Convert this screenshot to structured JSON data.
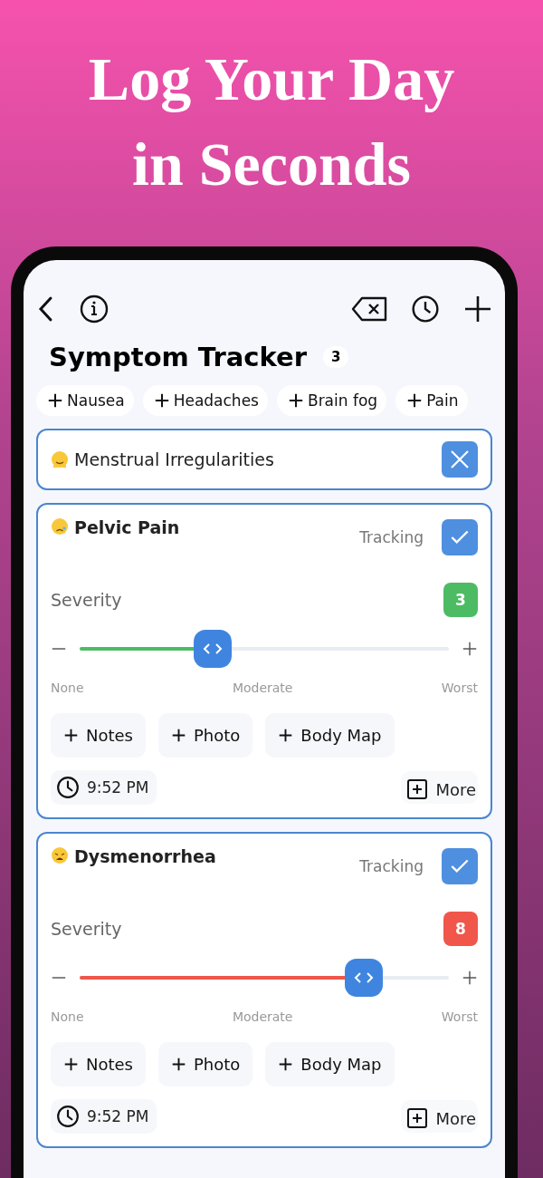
{
  "headline": "Log Your Day in Seconds",
  "screen": {
    "title": "Symptom Tracker",
    "count": "3",
    "quick_add": [
      "Nausea",
      "Headaches",
      "Brain fog",
      "Pain"
    ],
    "symptoms": [
      {
        "kind": "collapsed",
        "name": "Menstrual Irregularities",
        "tracking": false
      },
      {
        "kind": "expanded",
        "name": "Pelvic Pain",
        "tracking_label": "Tracking",
        "tracking": true,
        "severity_label": "Severity",
        "score": "3",
        "color": "#4cbb64",
        "level": 0.36,
        "scale": [
          "None",
          "Moderate",
          "Worst"
        ],
        "actions": [
          "Notes",
          "Photo",
          "Body Map"
        ],
        "time": "9:52 PM",
        "more": "More"
      },
      {
        "kind": "expanded",
        "name": "Dysmenorrhea",
        "tracking_label": "Tracking",
        "tracking": true,
        "severity_label": "Severity",
        "score": "8",
        "color": "#f0564a",
        "level": 0.77,
        "scale": [
          "None",
          "Moderate",
          "Worst"
        ],
        "actions": [
          "Notes",
          "Photo",
          "Body Map"
        ],
        "time": "9:52 PM",
        "more": "More"
      }
    ]
  }
}
